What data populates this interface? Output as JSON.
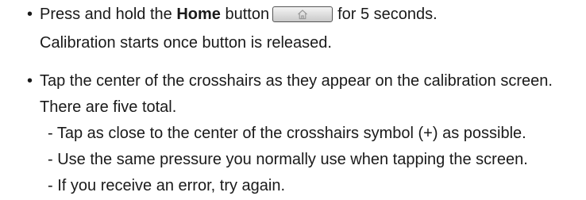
{
  "bullet_symbol": "•",
  "item1": {
    "text_before": "Press and hold the ",
    "bold_word": "Home",
    "text_middle": " button",
    "button_icon": "home-icon",
    "text_after": "for 5 seconds.",
    "continuation": "Calibration starts once button is released."
  },
  "item2": {
    "text": "Tap the center of the crosshairs as they appear on the calibration screen.",
    "continuation": "There are five total.",
    "sub_items": [
      "- Tap as close to the center of the crosshairs symbol (+) as possible.",
      "- Use the same pressure you normally use when tapping the screen.",
      "- If you receive an error, try again."
    ]
  }
}
